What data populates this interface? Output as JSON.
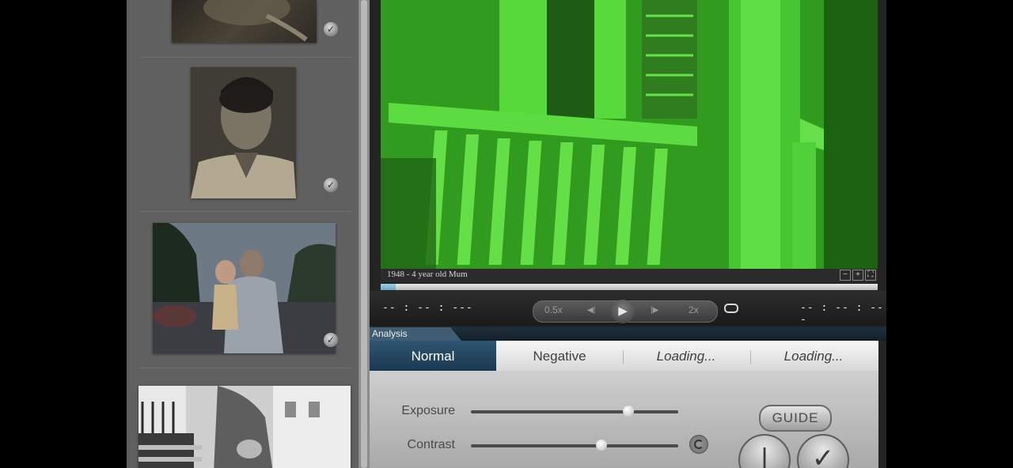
{
  "sidebar": {
    "thumbnails": [
      {
        "name": "thumb-1",
        "checked": true
      },
      {
        "name": "thumb-2",
        "checked": true
      },
      {
        "name": "thumb-3",
        "checked": true
      },
      {
        "name": "thumb-4",
        "checked": false
      }
    ]
  },
  "viewer": {
    "caption": "1948 - 4 year old Mum",
    "zoom": {
      "minus": "−",
      "plus": "+",
      "fit": "⛶"
    },
    "progress_fraction": 0.03,
    "timecode_current": "-- : -- : ---",
    "timecode_total": "-- : -- : ---",
    "controls": {
      "slow": "0.5x",
      "step_back": "◀|",
      "play": "▶",
      "step_forward": "|▶",
      "fast": "2x"
    }
  },
  "analysis": {
    "section_label": "Analysis",
    "tabs": [
      {
        "label": "Normal",
        "active": true
      },
      {
        "label": "Negative",
        "active": false
      },
      {
        "label": "Loading...",
        "active": false
      },
      {
        "label": "Loading...",
        "active": false
      }
    ],
    "sliders": [
      {
        "label": "Exposure",
        "value": 0.76
      },
      {
        "label": "Contrast",
        "value": 0.63
      }
    ],
    "guide_label": "GUIDE",
    "back_glyph": "|",
    "confirm_glyph": "✓"
  },
  "colors": {
    "accent_active_tab": "#2e5572",
    "frame": "#2d3f86",
    "video_tint": "#3fd52a"
  }
}
